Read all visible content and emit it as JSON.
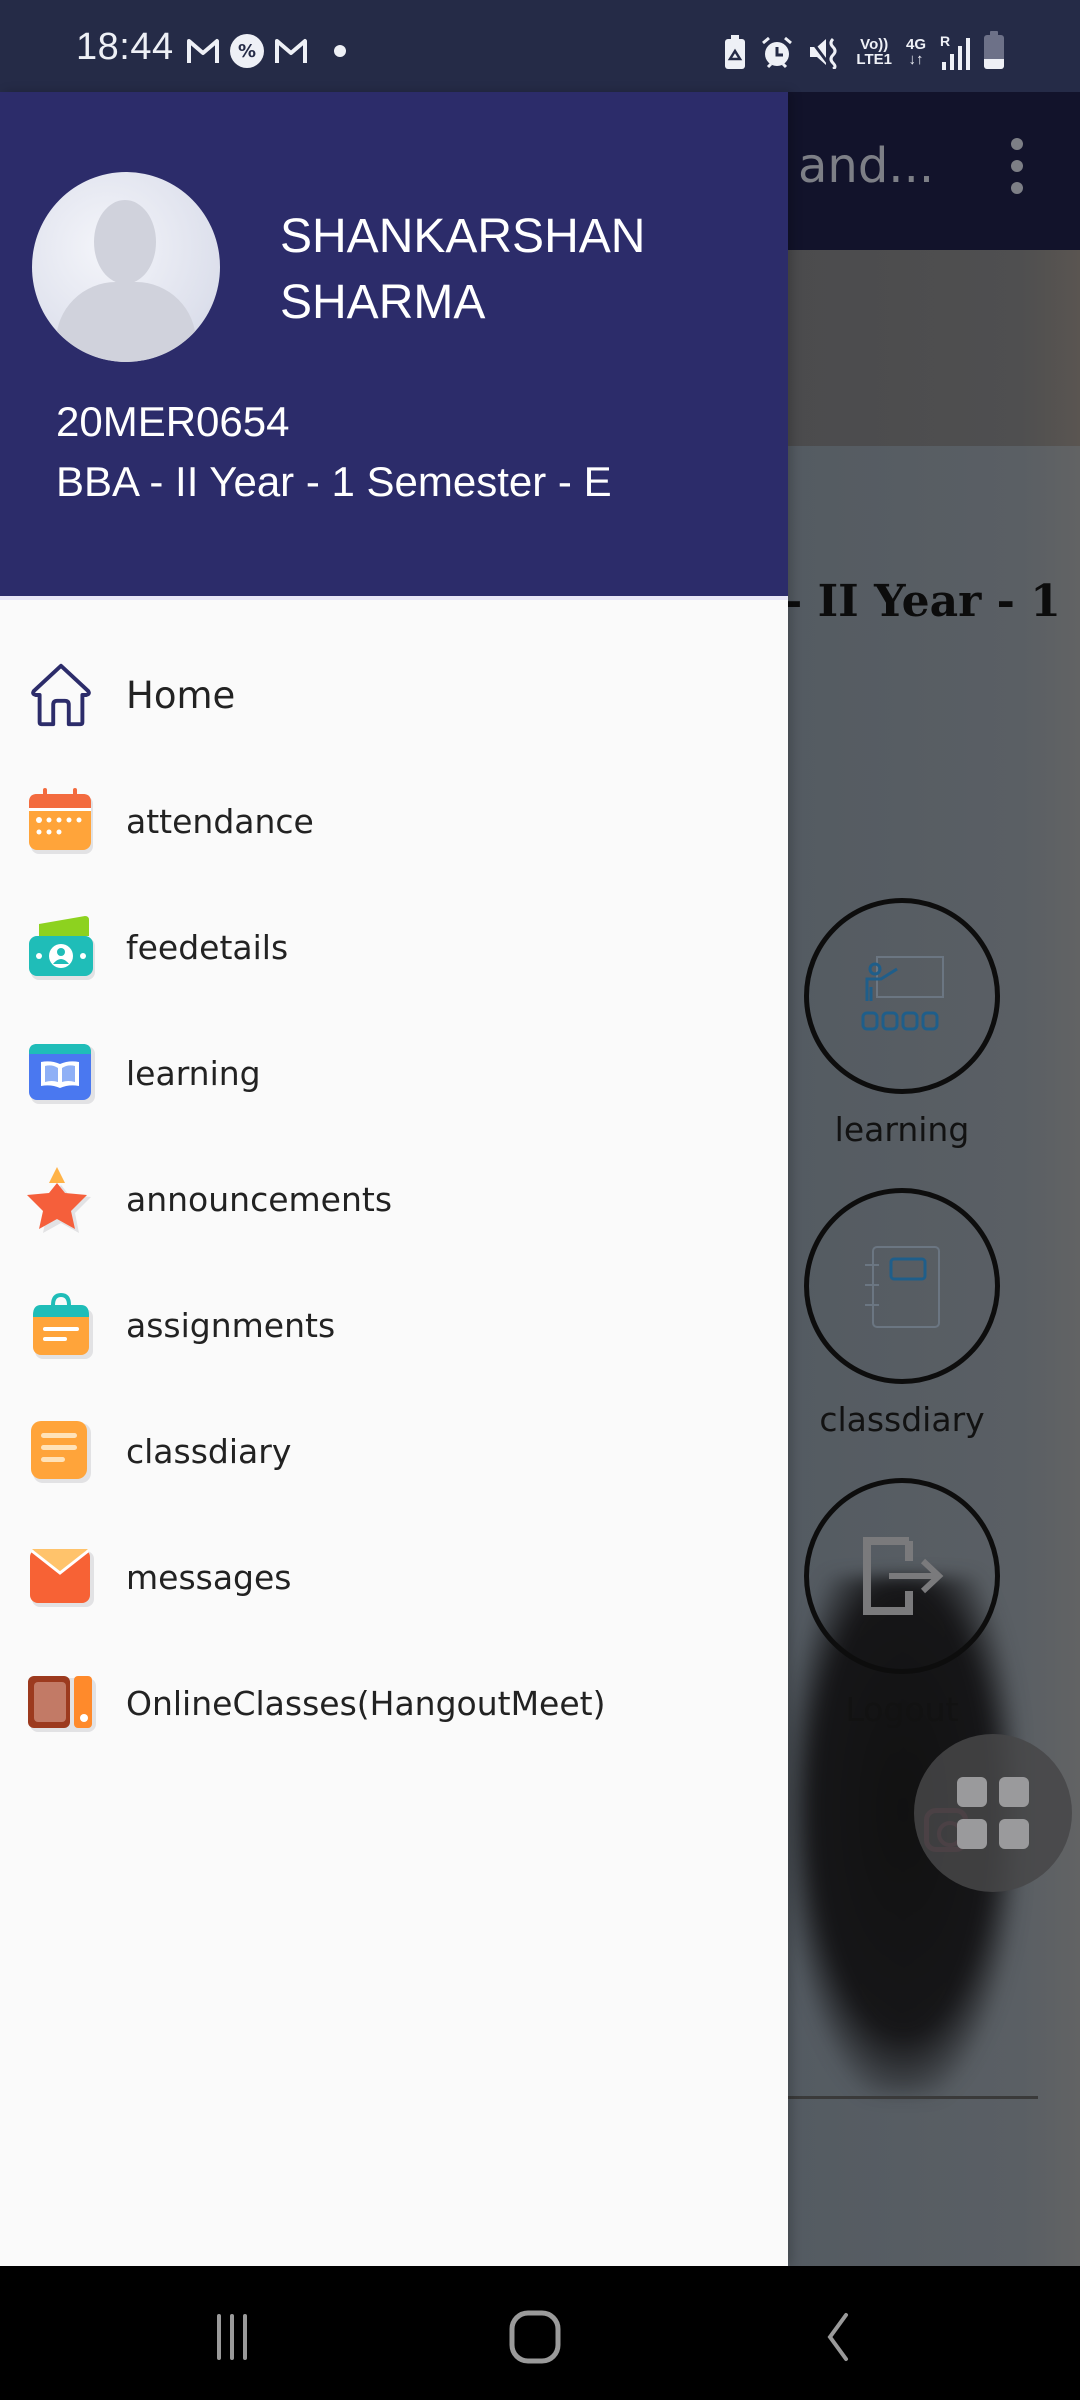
{
  "status_bar": {
    "time": "18:44",
    "left_icons": [
      "gmail-icon",
      "misc-app-icon",
      "gmail-icon",
      "notification-dot-icon"
    ],
    "right_icons": [
      "battery-saver-icon",
      "alarm-icon",
      "vibrate-mute-icon",
      "volte-icon",
      "data-4g-icon",
      "signal-roaming-icon",
      "battery-icon"
    ],
    "volte_label_top": "Vo))",
    "volte_label_bottom": "LTE1",
    "data_label_top": "4G",
    "data_label_bottom": "↓↑",
    "roaming_label": "R"
  },
  "drawer": {
    "profile": {
      "name_line1": "SHANKARSHAN",
      "name_line2": "SHARMA",
      "student_id": "20MER0654",
      "course": "BBA - II Year - 1 Semester - E"
    },
    "items": [
      {
        "label": "Home",
        "icon": "home-icon"
      },
      {
        "label": "attendance",
        "icon": "calendar-icon"
      },
      {
        "label": "feedetails",
        "icon": "money-icon"
      },
      {
        "label": "learning",
        "icon": "book-icon"
      },
      {
        "label": "announcements",
        "icon": "star-icon"
      },
      {
        "label": "assignments",
        "icon": "clipboard-icon"
      },
      {
        "label": "classdiary",
        "icon": "notes-icon"
      },
      {
        "label": "messages",
        "icon": "mail-icon"
      },
      {
        "label": "OnlineClasses(HangoutMeet)",
        "icon": "online-class-icon"
      }
    ]
  },
  "background_app": {
    "toolbar_title": "and...",
    "heading": "- II Year - 1",
    "tiles": [
      {
        "label": "learning",
        "icon": "teacher-class-icon"
      },
      {
        "label": "classdiary",
        "icon": "diary-icon"
      },
      {
        "label": "Logout",
        "icon": "logout-icon"
      }
    ]
  },
  "colors": {
    "header_bg": "#2c2c6a",
    "status_bar_bg": "#252b47",
    "drawer_bg": "#fafafa"
  }
}
